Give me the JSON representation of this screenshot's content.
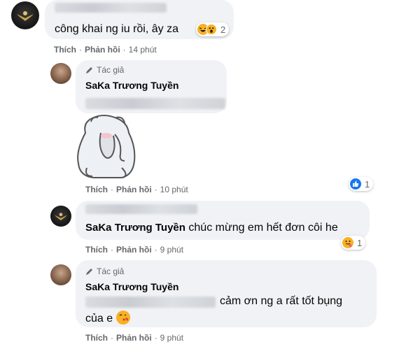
{
  "comments": [
    {
      "author_hidden": "Nhạc Đường Hay Hoàng",
      "text": "công khai ng iu rồi, ây za",
      "reaction_count": "2",
      "actions": {
        "like": "Thích",
        "reply": "Phản hồi",
        "time": "14 phút"
      }
    },
    {
      "badge": "Tác giả",
      "author": "SaKa Trương Tuyền",
      "actions": {
        "like": "Thích",
        "reply": "Phản hồi",
        "time": "10 phút"
      },
      "reaction_count": "1"
    },
    {
      "author_hidden": "Nhạc Đường Hay Hoàng",
      "mention": "SaKa Trương Tuyền",
      "text": "chúc mừng em hết đơn côi he",
      "actions": {
        "like": "Thích",
        "reply": "Phản hồi",
        "time": "9 phút"
      },
      "reaction_count": "1"
    },
    {
      "badge": "Tác giả",
      "author": "SaKa Trương Tuyền",
      "text_line1": "cảm ơn ng a rất tốt bụng",
      "text_line2": "của e",
      "actions": {
        "like": "Thích",
        "reply": "Phản hồi",
        "time": "9 phút"
      }
    }
  ],
  "colors": {
    "bubble": "#f0f2f5",
    "meta": "#65676b",
    "like_blue": "#1877f2",
    "emoji_yellow": "#f7b125"
  },
  "icons": [
    "user-avatar-bird-icon",
    "user-avatar-girl-icon",
    "pencil-icon",
    "haha-reaction-icon",
    "wow-reaction-icon",
    "like-reaction-icon",
    "care-reaction-icon",
    "kiss-emoji-icon",
    "shy-bear-sticker"
  ]
}
